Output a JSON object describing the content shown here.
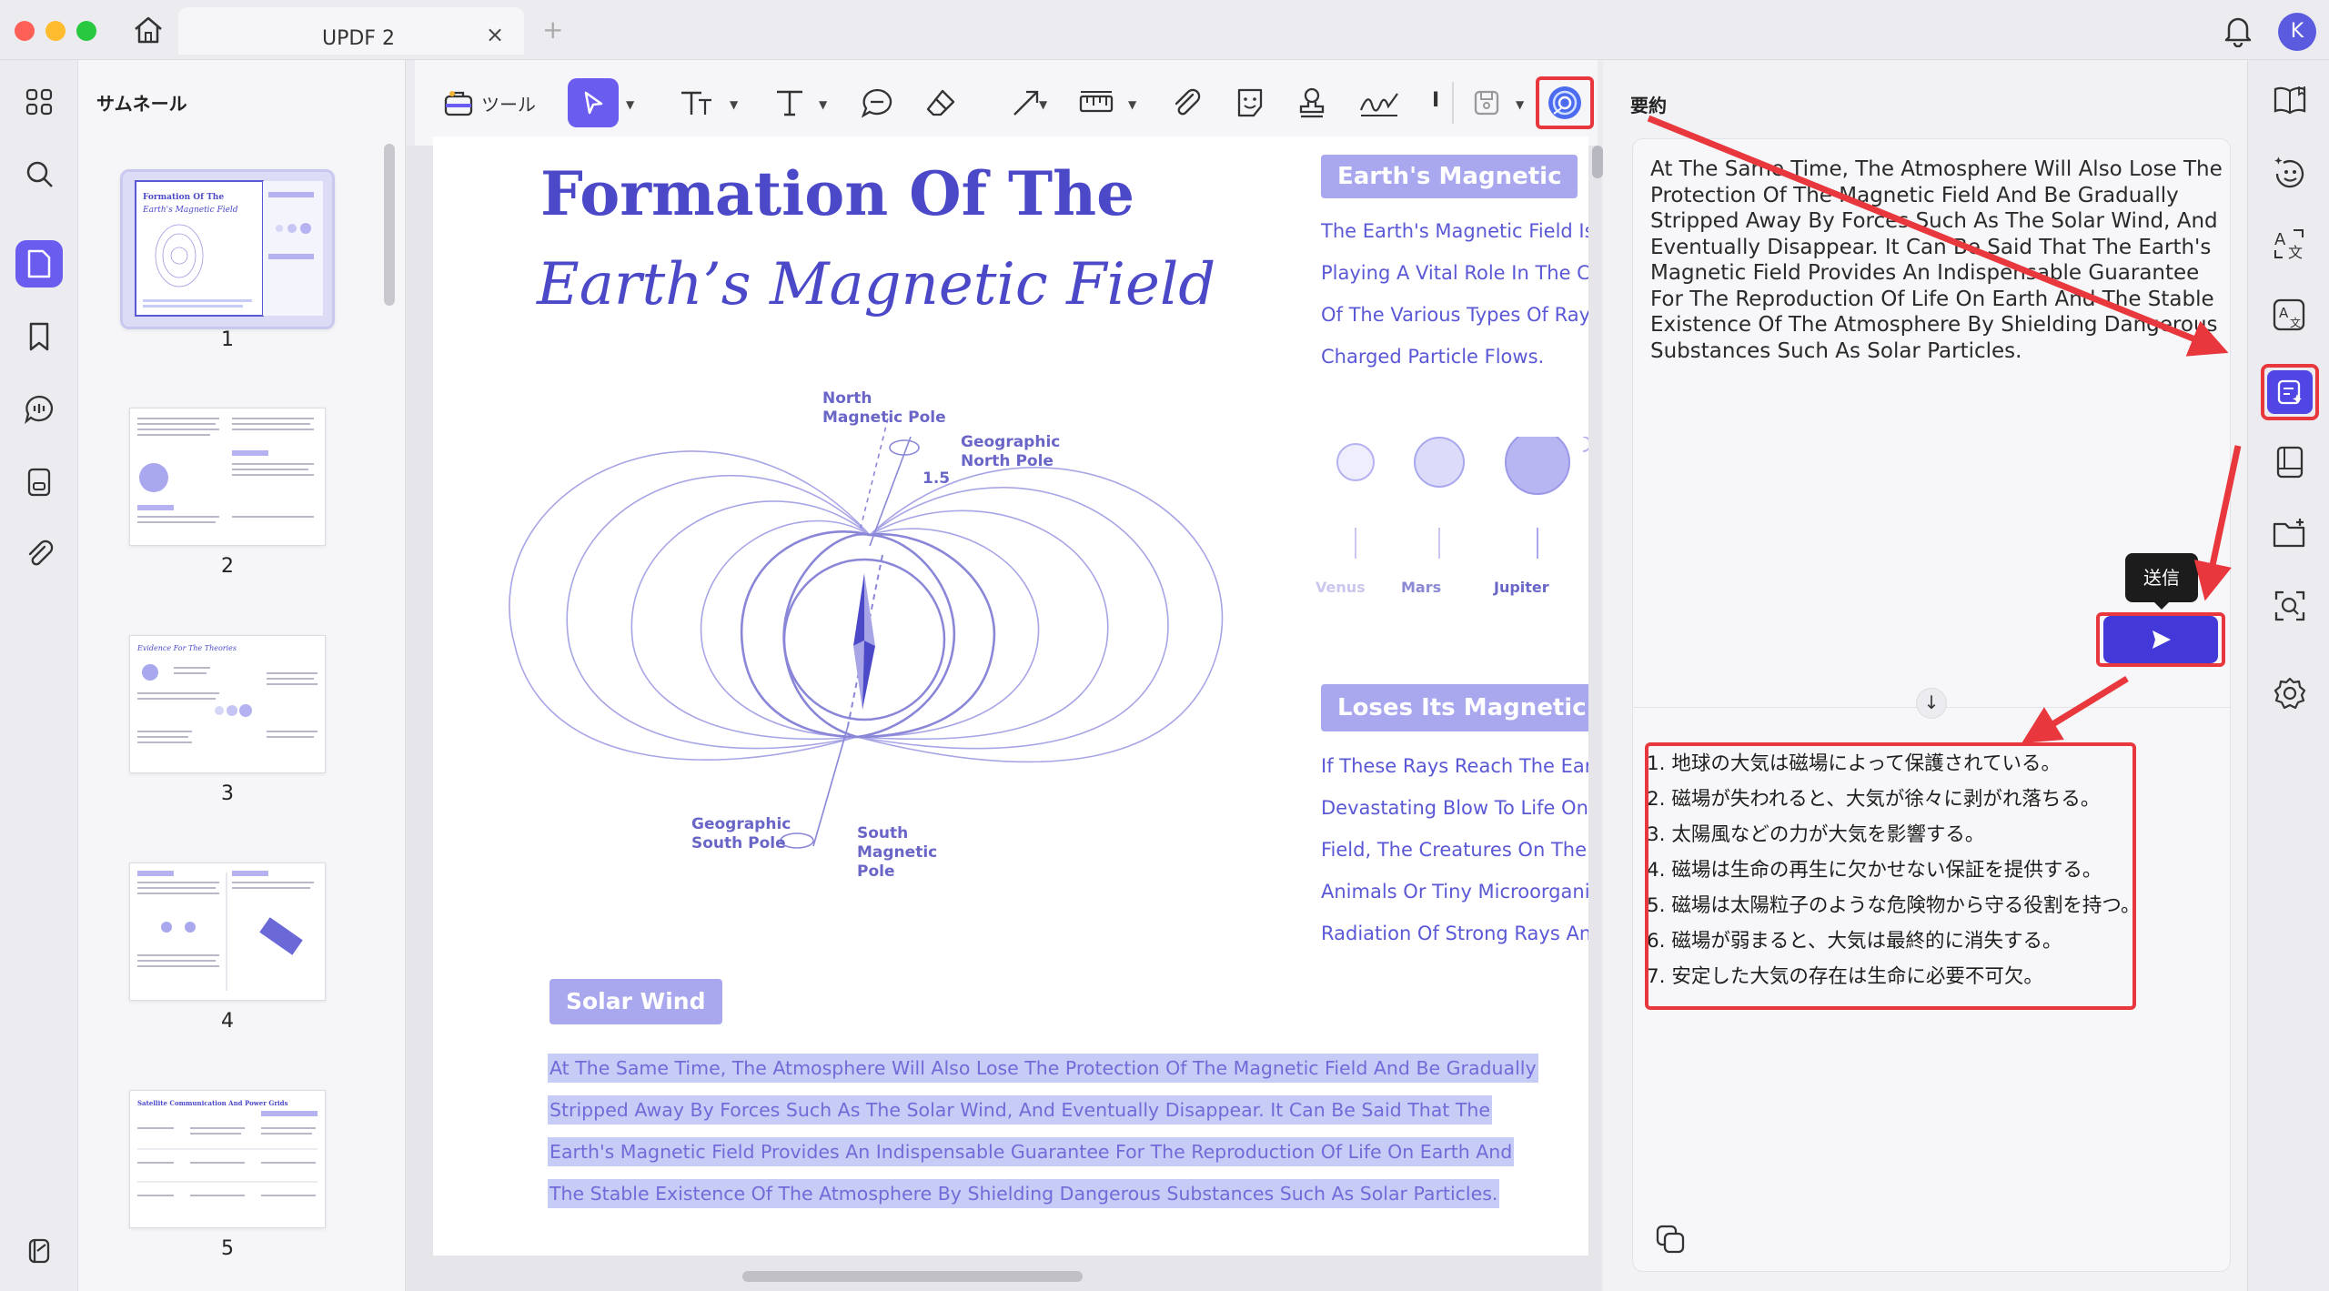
{
  "window": {
    "tab_title": "UPDF 2",
    "tab_close": "×",
    "tab_new": "+",
    "avatar_initial": "K"
  },
  "thumbnails": {
    "title": "サムネール",
    "pages": [
      "1",
      "2",
      "3",
      "4",
      "5"
    ],
    "selected_page": "1"
  },
  "toolbar": {
    "tools_label": "ツール",
    "overflow_label": "I"
  },
  "document": {
    "title_line1": "Formation Of The",
    "title_line2": "Earth’s Magnetic Field",
    "diagram_labels": {
      "north_magnetic": "North\nMagnetic Pole",
      "geo_north": "Geographic\nNorth Pole",
      "angle": "1.5",
      "geo_south": "Geographic\nSouth Pole",
      "south_magnetic": "South\nMagnetic\nPole"
    },
    "sidebar_heading_1": "Earth's Magnetic",
    "sidebar_lines_1": [
      "The Earth's Magnetic Field Is L",
      "Playing A Vital Role In The Co",
      "Of The Various Types Of Rays",
      "Charged Particle Flows."
    ],
    "planets": [
      "Venus",
      "Mars",
      "Jupiter"
    ],
    "sidebar_heading_2": "Loses Its Magnetic Field",
    "sidebar_lines_2": [
      "If These Rays Reach The Eart",
      "Devastating Blow To Life On E",
      "Field, The Creatures On The E",
      "Animals Or Tiny Microorganism",
      "Radiation Of Strong Rays And"
    ],
    "section_heading": "Solar Wind",
    "highlighted_lines": [
      "At The Same Time, The Atmosphere Will Also Lose The Protection Of The Magnetic Field And Be Gradually",
      "Stripped Away By Forces Such As The Solar Wind, And Eventually Disappear. It Can Be Said That The",
      "Earth's Magnetic Field Provides An Indispensable Guarantee For The Reproduction Of Life On Earth And",
      "The Stable Existence Of The Atmosphere By Shielding Dangerous Substances Such As Solar Particles."
    ]
  },
  "ai_panel": {
    "title": "要約",
    "input_text": "At The Same Time, The Atmosphere Will Also Lose The Protection Of The Magnetic Field And Be Gradually Stripped Away By Forces Such As The Solar Wind, And Eventually Disappear. It Can Be Said That The Earth's Magnetic Field Provides An Indispensable Guarantee For The Reproduction Of Life On Earth And The Stable Existence Of The Atmosphere By Shielding Dangerous Substances Such As Solar Particles.",
    "send_tooltip": "送信",
    "scroll_down": "↓",
    "results": [
      "1. 地球の大気は磁場によって保護されている。",
      "2. 磁場が失われると、大気が徐々に剥がれ落ちる。",
      "3. 太陽風などの力が大気を影響する。",
      "4. 磁場は生命の再生に欠かせない保証を提供する。",
      "5. 磁場は太陽粒子のような危険物から守る役割を持つ。",
      "6. 磁場が弱まると、大気は最終的に消失する。",
      "7. 安定した大気の存在は生命に必要不可欠。"
    ]
  },
  "colors": {
    "accent": "#4338d8",
    "doc_purple": "#4b49c8",
    "highlight": "#c7ccf6",
    "annotation_red": "#e8383d"
  },
  "icons": {
    "left_rail": [
      "grid-icon",
      "search-icon",
      "page-icon",
      "bookmark-icon",
      "comment-icon",
      "form-icon",
      "attachment-icon",
      "layers-icon"
    ],
    "right_rail": [
      "book-icon",
      "ai-face-icon",
      "translate-icon",
      "ocr-icon",
      "summary-icon",
      "reader-icon",
      "folder-add-icon",
      "scan-search-icon",
      "settings-icon"
    ]
  }
}
